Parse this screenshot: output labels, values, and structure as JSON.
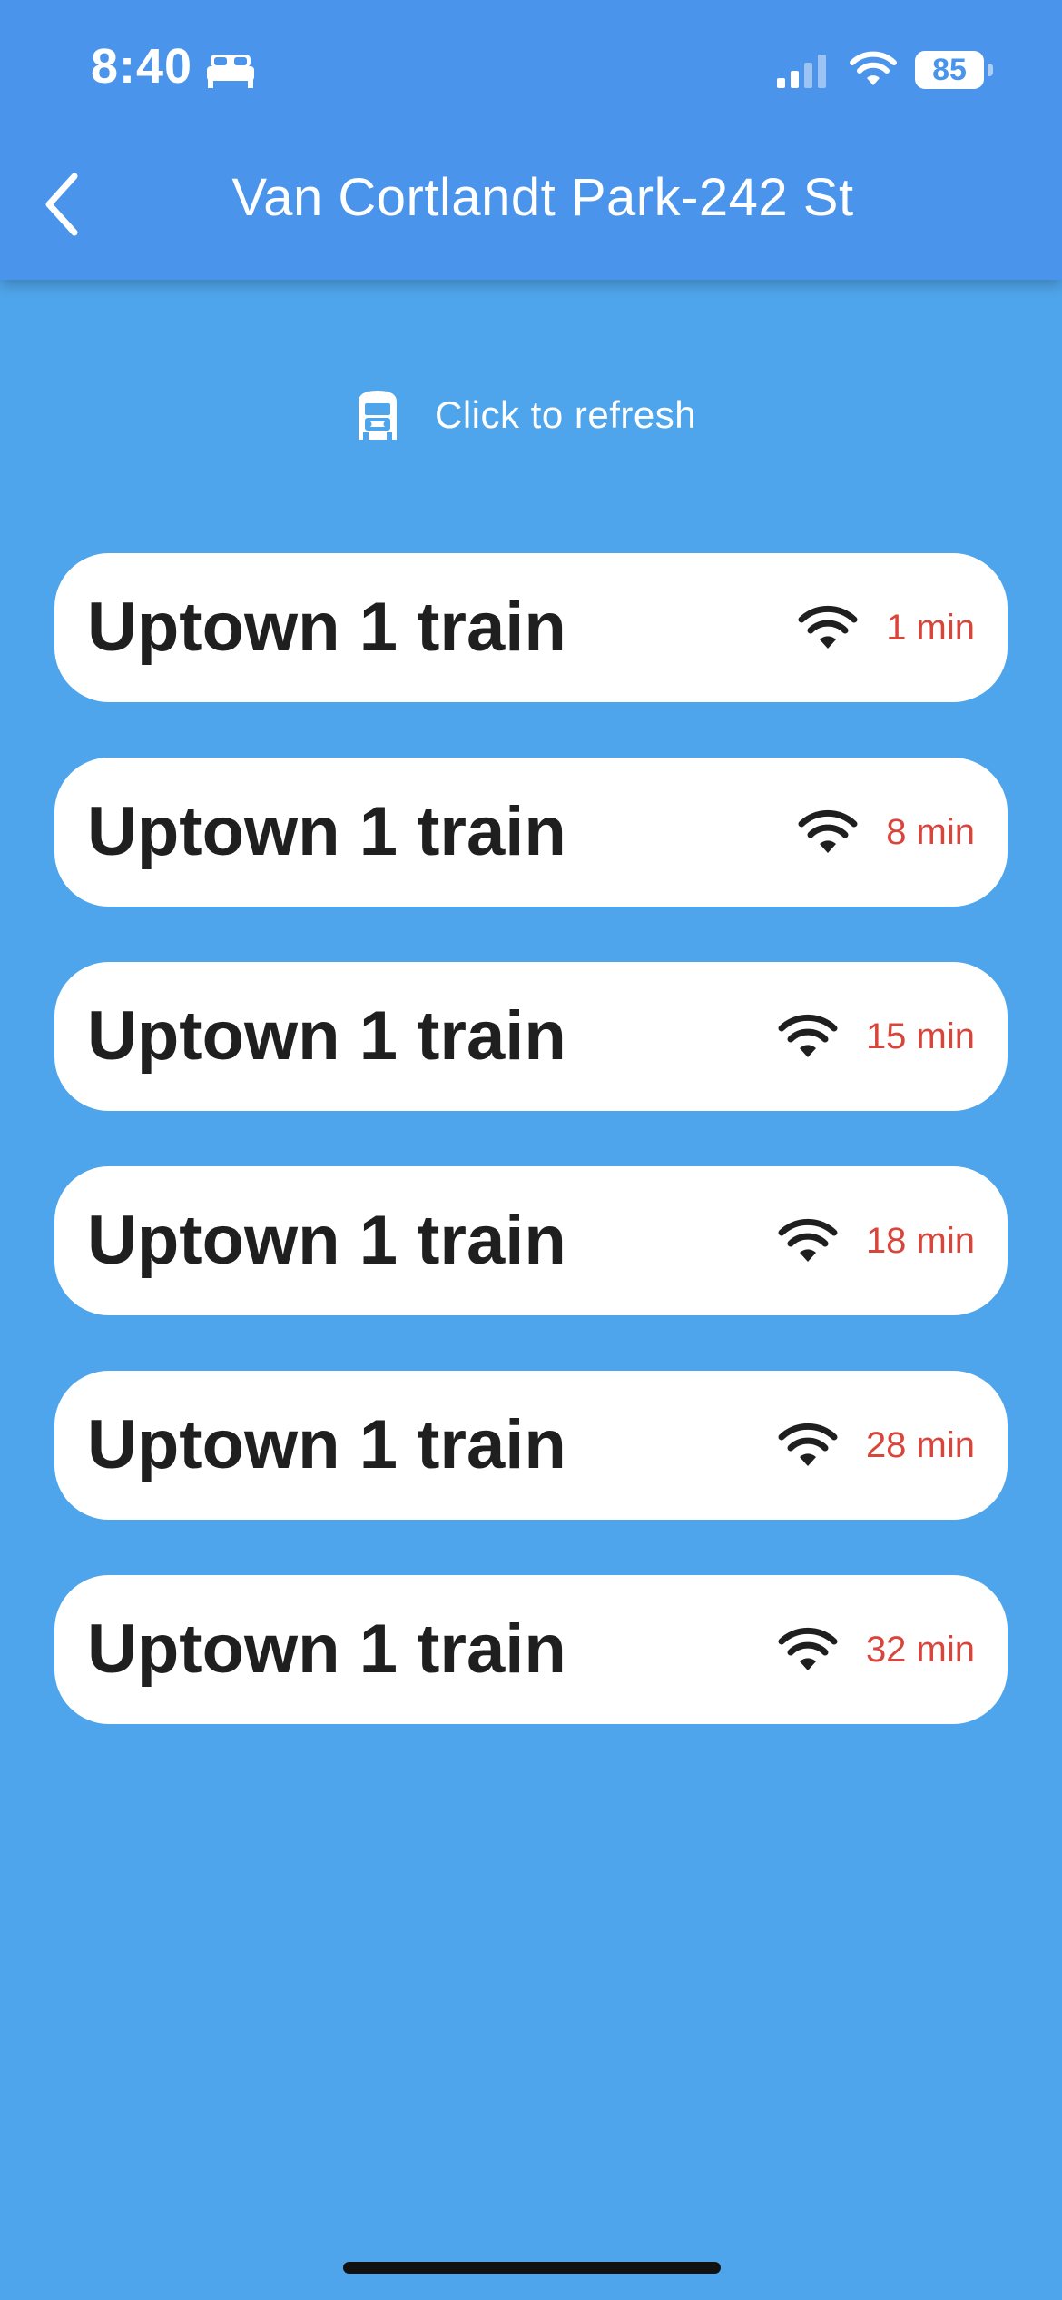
{
  "status_bar": {
    "time": "8:40",
    "battery": "85"
  },
  "header": {
    "title": "Van Cortlandt Park-242 St"
  },
  "refresh": {
    "label": "Click to refresh"
  },
  "arrivals": [
    {
      "line": "Uptown 1 train",
      "eta": "1 min"
    },
    {
      "line": "Uptown 1 train",
      "eta": "8 min"
    },
    {
      "line": "Uptown 1 train",
      "eta": "15 min"
    },
    {
      "line": "Uptown 1 train",
      "eta": "18 min"
    },
    {
      "line": "Uptown 1 train",
      "eta": "28 min"
    },
    {
      "line": "Uptown 1 train",
      "eta": "32 min"
    }
  ],
  "icons": {
    "back": "chevron-left-icon",
    "refresh": "train-icon",
    "realtime": "wifi-icon",
    "status_focus": "bed-icon"
  },
  "colors": {
    "header_background": "#4A94EB",
    "page_background": "#4FA5EB",
    "card_background": "#FFFFFF",
    "eta_text": "#D8453B",
    "line_text": "#1F1F1F"
  }
}
